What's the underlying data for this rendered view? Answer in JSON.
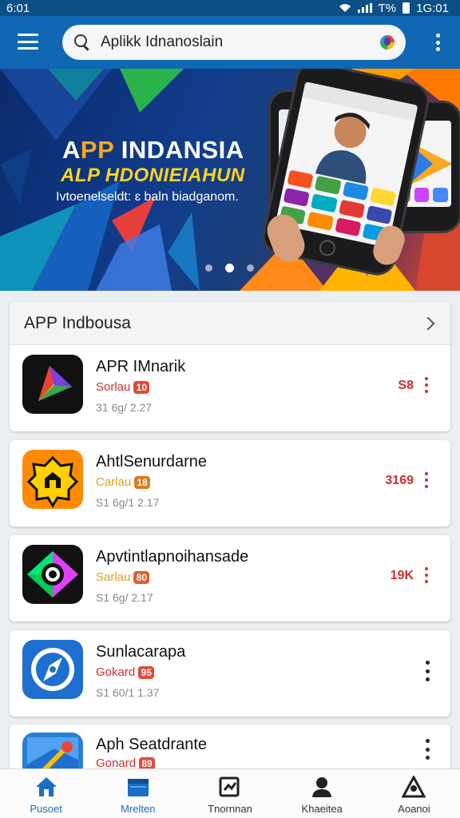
{
  "status_bar": {
    "time": "6:01",
    "right_text": "Ƭ%",
    "battery": "1G:01"
  },
  "search": {
    "value": "Aplikk Idnanoslain"
  },
  "banner": {
    "title_prefix": "A",
    "title_accent": "PP",
    "title_rest": " INDANSIA",
    "subtitle": "ALP HDONIEIAHUN",
    "tagline": "Ivtoenelseldt: ɛ baln biadganom.",
    "dots": 3,
    "active_dot": 1
  },
  "section": {
    "title": "APP Indbousa"
  },
  "apps": [
    {
      "name": "APR IMnarik",
      "meta": "Sorlau",
      "badge": "10",
      "sub": "31 6g/ 2.27",
      "right": "S8",
      "meta_color": "#d12d2d",
      "badge_color": "#e04a3a",
      "icon": "play-triangle-icon"
    },
    {
      "name": "AhtlSenurdarne",
      "meta": "Carlau",
      "badge": "18",
      "sub": "S1 6g/1 2.17",
      "right": "3169",
      "meta_color": "#e0a020",
      "badge_color": "#e07a20",
      "icon": "house-badge-icon"
    },
    {
      "name": "Apvtintlapnoihansade",
      "meta": "Sarlau",
      "badge": "80",
      "sub": "S1 6g/ 2.17",
      "right": "19K",
      "meta_color": "#e0a020",
      "badge_color": "#e06030",
      "icon": "ring-diamond-icon"
    },
    {
      "name": "Sunlacarapa",
      "meta": "Gokard",
      "badge": "95",
      "sub": "S1 60/1 1.37",
      "right": "",
      "meta_color": "#d12d2d",
      "badge_color": "#e04a3a",
      "icon": "compass-icon"
    },
    {
      "name": "Aph Seatdrante",
      "meta": "Gonard",
      "badge": "89",
      "sub": "",
      "right": "",
      "meta_color": "#d12d2d",
      "badge_color": "#e04a3a",
      "icon": "map-pin-icon"
    }
  ],
  "nav": [
    {
      "label": "Pusoet",
      "icon": "home-icon"
    },
    {
      "label": "Mrelten",
      "icon": "folder-icon"
    },
    {
      "label": "Tnornnan",
      "icon": "edit-square-icon"
    },
    {
      "label": "Khaeitea",
      "icon": "person-icon"
    },
    {
      "label": "Aoanoi",
      "icon": "account-icon"
    }
  ],
  "colors": {
    "app_bar": "#1067b3",
    "status_bar": "#0c4f86",
    "accent": "#1a6fc4",
    "badge_red": "#e04a3a"
  }
}
